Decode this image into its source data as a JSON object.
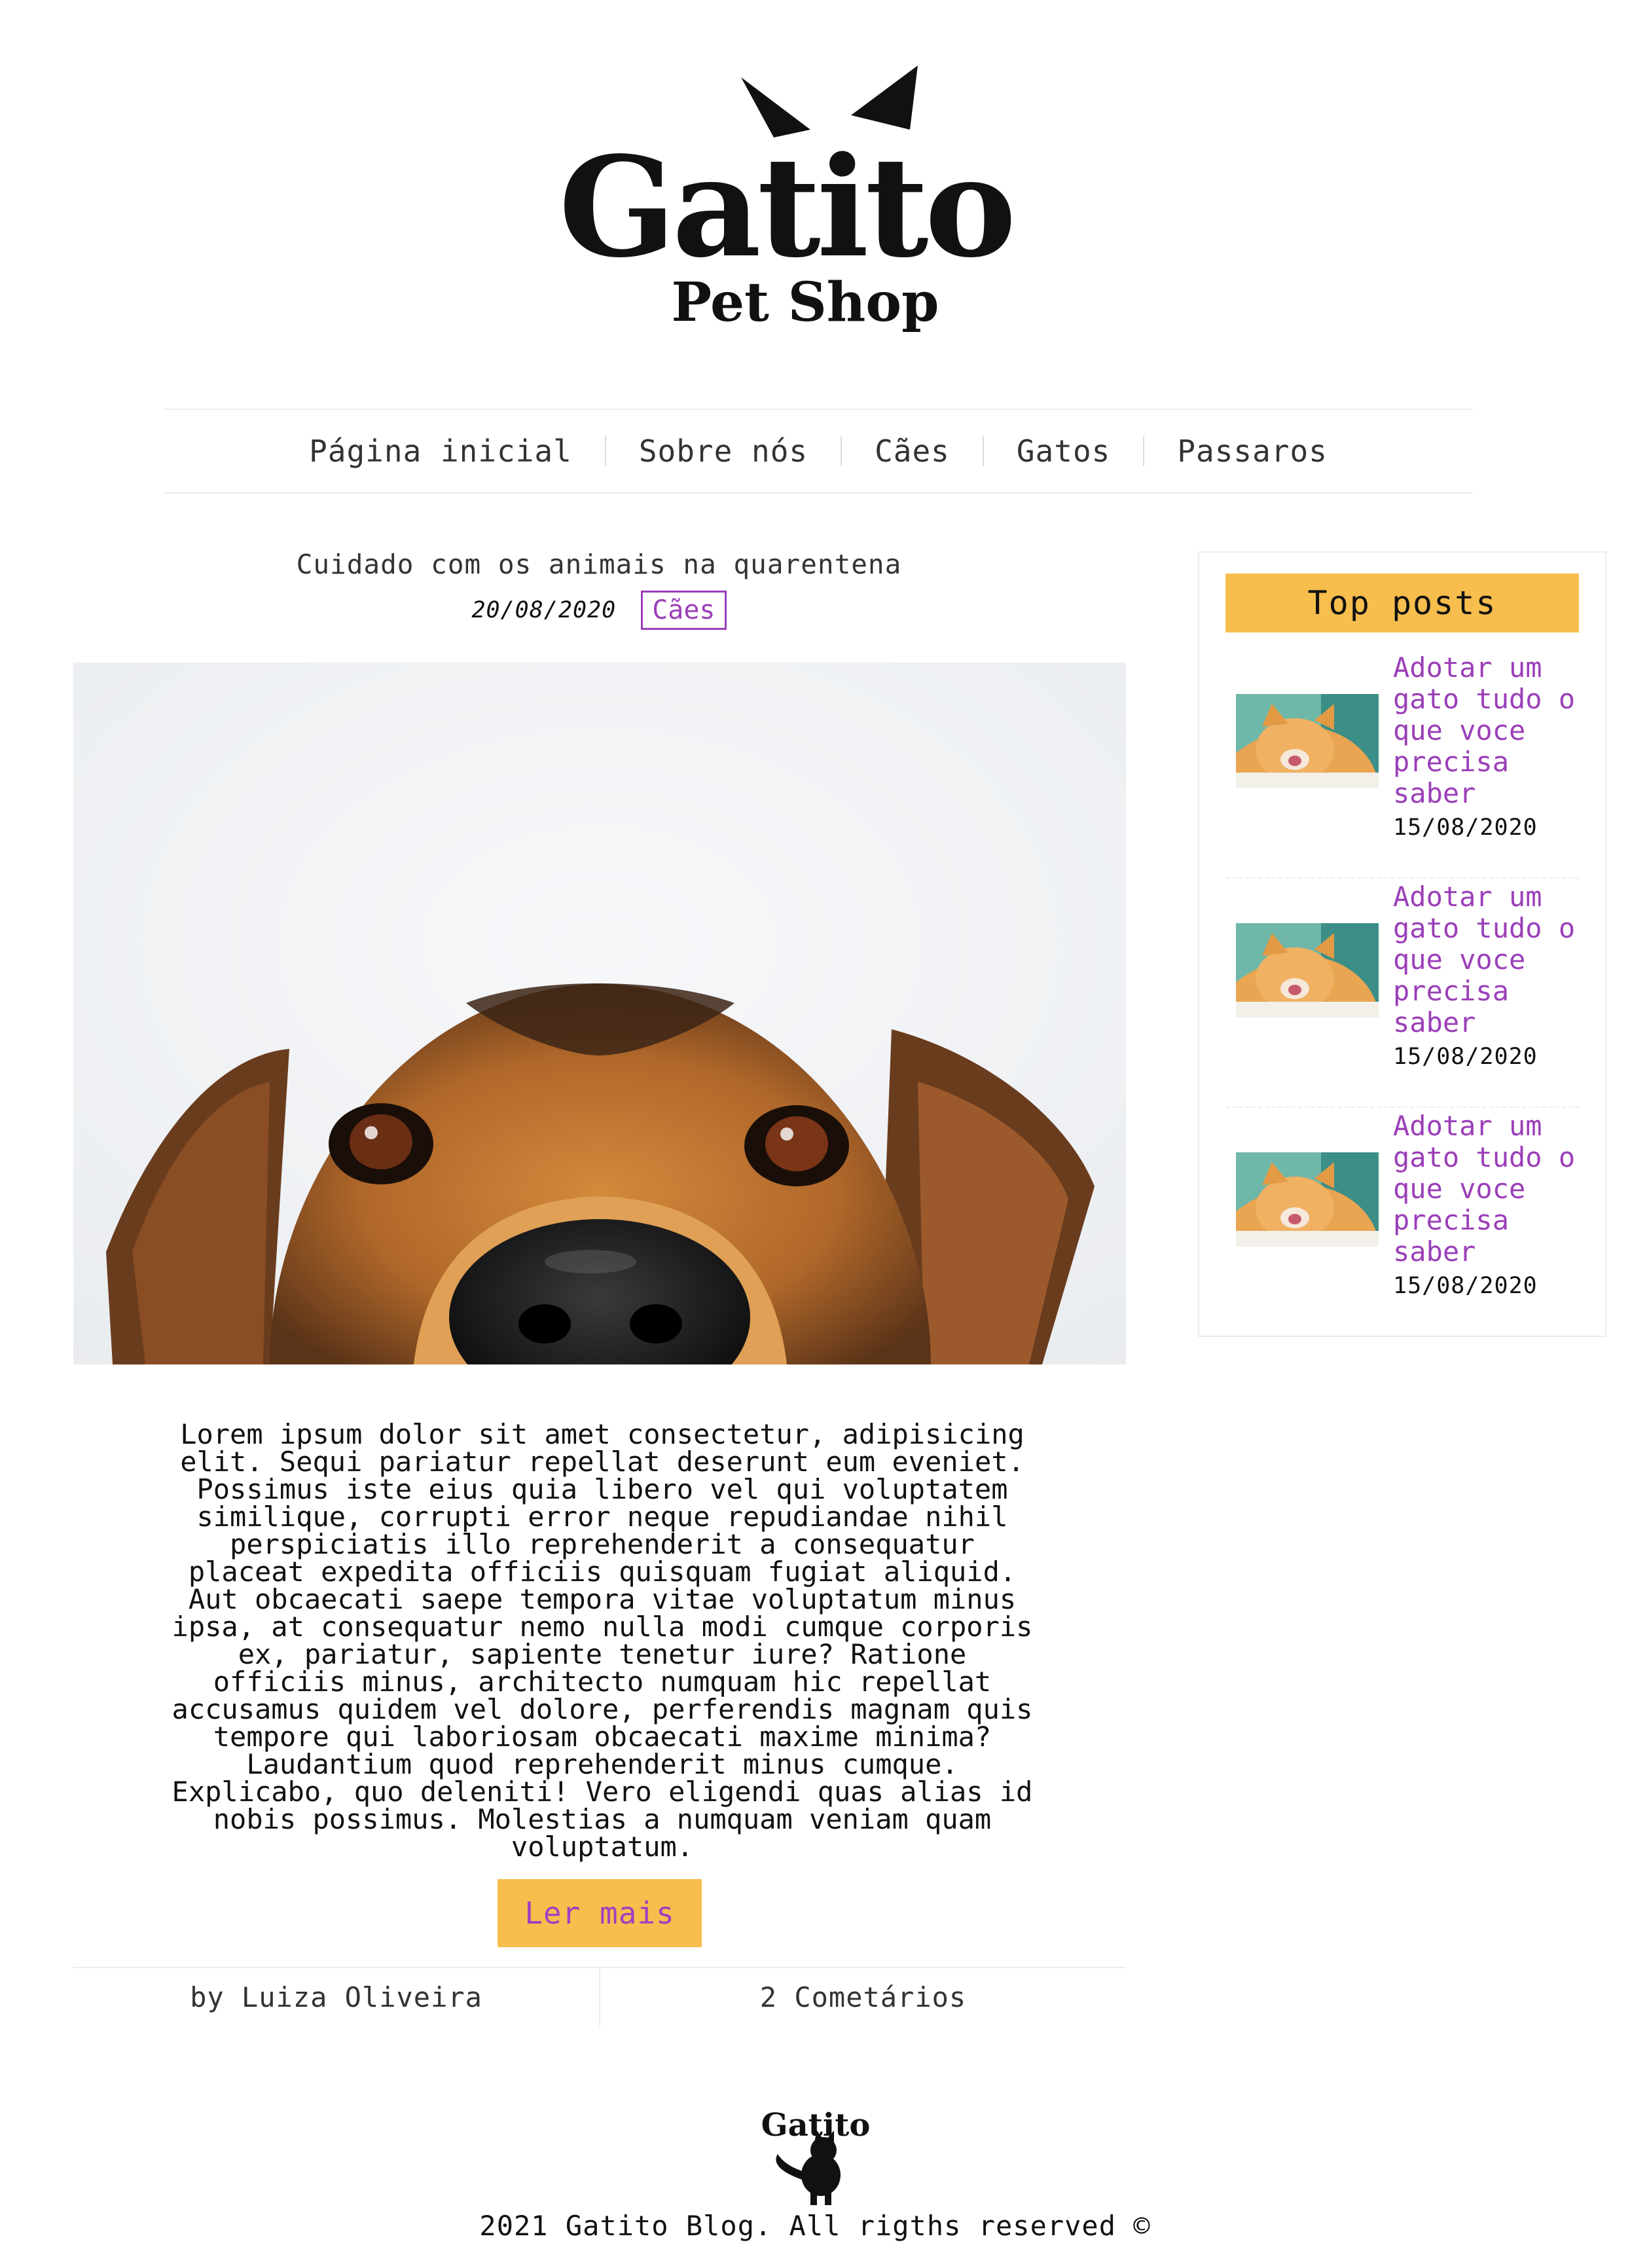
{
  "header": {
    "logo_title": "Gatito",
    "logo_subtitle": "Pet Shop"
  },
  "nav": {
    "items": [
      {
        "label": "Página inicial"
      },
      {
        "label": "Sobre nós"
      },
      {
        "label": "Cães"
      },
      {
        "label": "Gatos"
      },
      {
        "label": "Passaros"
      }
    ]
  },
  "post": {
    "title": "Cuidado com os animais na quarentena",
    "date": "20/08/2020",
    "tag": "Cães",
    "body": "Lorem ipsum dolor sit amet consectetur, adipisicing elit. Sequi pariatur repellat deserunt eum eveniet. Possimus iste eius quia libero vel qui voluptatem similique, corrupti error neque repudiandae nihil perspiciatis illo reprehenderit a consequatur placeat expedita officiis quisquam fugiat aliquid. Aut obcaecati saepe tempora vitae voluptatum minus ipsa, at consequatur nemo nulla modi cumque corporis ex, pariatur, sapiente tenetur iure? Ratione officiis minus, architecto numquam hic repellat accusamus quidem vel dolore, perferendis magnam quis tempore qui laboriosam obcaecati maxime minima? Laudantium quod reprehenderit minus cumque. Explicabo, quo deleniti! Vero eligendi quas alias id nobis possimus. Molestias a numquam veniam quam voluptatum.",
    "read_more": "Ler mais",
    "author": "by Luiza Oliveira",
    "comments": "2 Cometários"
  },
  "sidebar": {
    "title": "Top posts",
    "posts": [
      {
        "title": "Adotar um gato tudo o que voce precisa saber",
        "date": "15/08/2020"
      },
      {
        "title": "Adotar um gato tudo o que voce precisa saber",
        "date": "15/08/2020"
      },
      {
        "title": "Adotar um gato tudo o que voce precisa saber",
        "date": "15/08/2020"
      }
    ]
  },
  "footer": {
    "logo_text": "Gatito",
    "text": "2021 Gatito Blog. All rigths reserved ©"
  },
  "colors": {
    "accent": "#f7be4d",
    "link": "#9b3fb8"
  }
}
